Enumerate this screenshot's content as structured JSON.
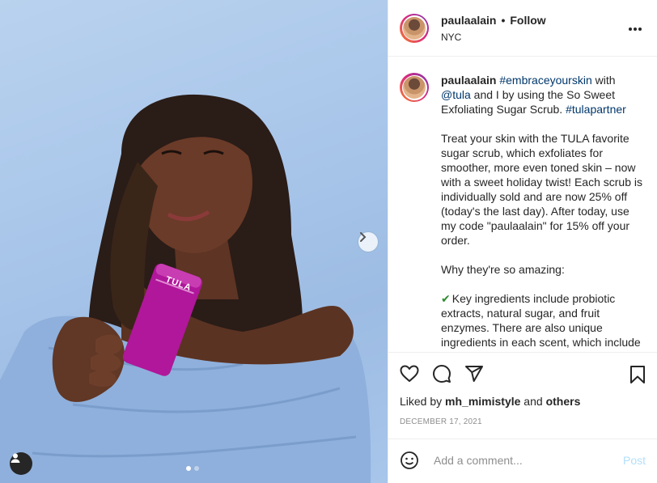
{
  "header": {
    "username": "paulaalain",
    "separator": "•",
    "follow_label": "Follow",
    "location": "NYC",
    "more_icon": "more-horizontal-icon"
  },
  "caption": {
    "username": "paulaalain",
    "line1_tag": "#embraceyourskin",
    "line1_mid": " with ",
    "line1_mention": "@tula",
    "line2": " and I by using the So Sweet Exfoliating Sugar Scrub. ",
    "partner_tag": "#tulapartner",
    "para1": "Treat your skin with the TULA favorite sugar scrub, which exfoliates for smoother, more even toned skin – now with a sweet holiday twist! Each scrub is individually sold and are now 25% off (today's the last day). After today, use my code \"paulaalain\" for 15% off your order.",
    "para2": "Why they're so amazing:",
    "check_icon": "check-mark-icon",
    "para3": "Key ingredients include probiotic extracts, natural sugar, and fruit enzymes. There are also unique ingredients in each scent, which include"
  },
  "product": {
    "brand": "TULA"
  },
  "actions": {
    "like_icon": "heart-icon",
    "comment_icon": "comment-icon",
    "share_icon": "share-icon",
    "save_icon": "bookmark-icon"
  },
  "likes": {
    "prefix": "Liked by ",
    "user": "mh_mimistyle",
    "and": " and ",
    "others": "others"
  },
  "date": "DECEMBER 17, 2021",
  "comment": {
    "placeholder": "Add a comment...",
    "post_label": "Post"
  },
  "carousel": {
    "total": 2,
    "current": 1
  },
  "colors": {
    "link": "#00376b",
    "post_disabled": "#b2dffc",
    "photo_bg": "#a9c6ea"
  }
}
